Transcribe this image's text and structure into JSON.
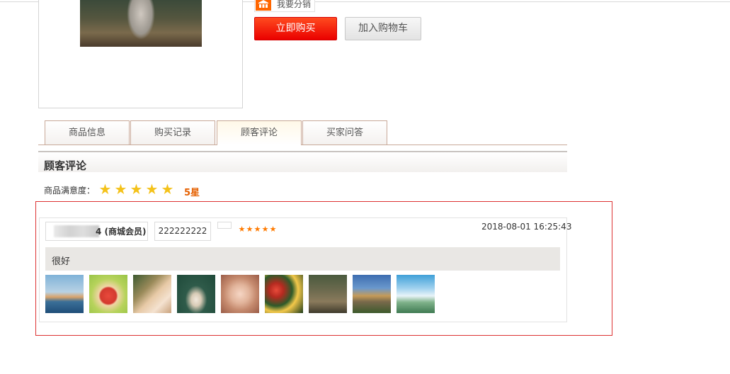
{
  "product": {
    "share_label": "我要分销",
    "share_icon": "share-shop-icon",
    "buy_now_label": "立即购买",
    "add_to_cart_label": "加入购物车"
  },
  "tabs": [
    {
      "label": "商品信息",
      "active": false
    },
    {
      "label": "购买记录",
      "active": false
    },
    {
      "label": "顾客评论",
      "active": true
    },
    {
      "label": "买家问答",
      "active": false
    }
  ],
  "reviews_section": {
    "title": "顾客评论",
    "satisfaction_label": "商品满意度：",
    "satisfaction_stars": 5,
    "satisfaction_score": "5星"
  },
  "review": {
    "user_suffix": "4 (商城会员)",
    "order_no": "222222222",
    "rating_stars": 5,
    "date": "2018-08-01 16:25:43",
    "comment": "很好",
    "image_count": 9
  },
  "colors": {
    "buy_button": "#ea0000",
    "highlight_border": "#dd3333",
    "star_gold": "#f4c21a",
    "star_orange": "#ff7a00",
    "score_text": "#e56000"
  }
}
